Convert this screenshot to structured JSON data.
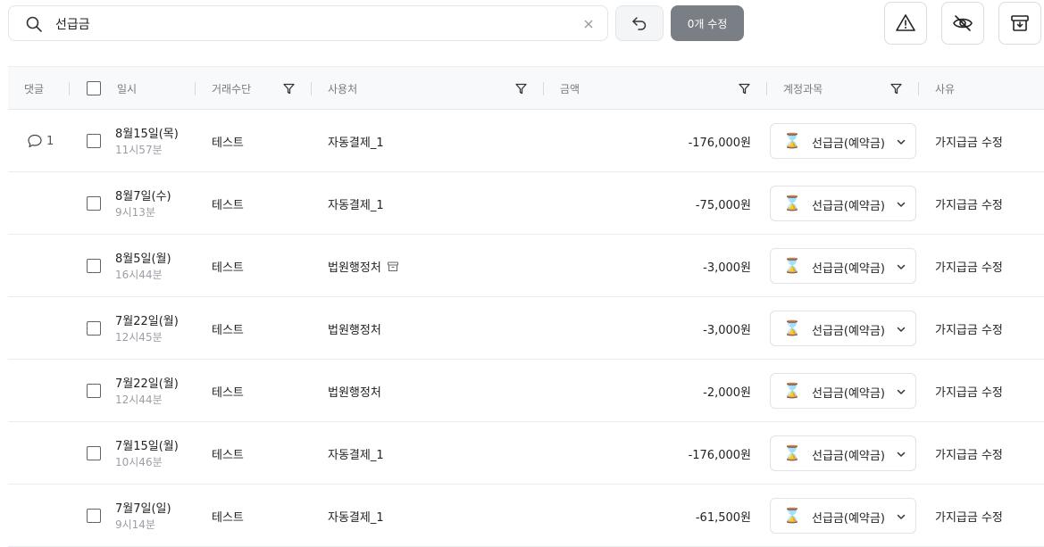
{
  "search": {
    "value": "선급금",
    "placeholder": ""
  },
  "toolbar": {
    "edit_label": "0개 수정"
  },
  "table": {
    "headers": {
      "comment": "댓글",
      "date": "일시",
      "method": "거래수단",
      "merchant": "사용처",
      "amount": "금액",
      "account": "계정과목",
      "reason": "사유"
    },
    "rows": [
      {
        "comments": "1",
        "date": "8월15일(목)",
        "time": "11시57분",
        "method": "테스트",
        "merchant": "자동결제_1",
        "amount": "-176,000원",
        "account": "선급금(예약금)",
        "reason": "가지급금 수정",
        "archived": false
      },
      {
        "comments": "",
        "date": "8월7일(수)",
        "time": "9시13분",
        "method": "테스트",
        "merchant": "자동결제_1",
        "amount": "-75,000원",
        "account": "선급금(예약금)",
        "reason": "가지급금 수정",
        "archived": false
      },
      {
        "comments": "",
        "date": "8월5일(월)",
        "time": "16시44분",
        "method": "테스트",
        "merchant": "법원행정처",
        "amount": "-3,000원",
        "account": "선급금(예약금)",
        "reason": "가지급금 수정",
        "archived": true
      },
      {
        "comments": "",
        "date": "7월22일(월)",
        "time": "12시45분",
        "method": "테스트",
        "merchant": "법원행정처",
        "amount": "-3,000원",
        "account": "선급금(예약금)",
        "reason": "가지급금 수정",
        "archived": false
      },
      {
        "comments": "",
        "date": "7월22일(월)",
        "time": "12시44분",
        "method": "테스트",
        "merchant": "법원행정처",
        "amount": "-2,000원",
        "account": "선급금(예약금)",
        "reason": "가지급금 수정",
        "archived": false
      },
      {
        "comments": "",
        "date": "7월15일(월)",
        "time": "10시46분",
        "method": "테스트",
        "merchant": "자동결제_1",
        "amount": "-176,000원",
        "account": "선급금(예약금)",
        "reason": "가지급금 수정",
        "archived": false
      },
      {
        "comments": "",
        "date": "7월7일(일)",
        "time": "9시14분",
        "method": "테스트",
        "merchant": "자동결제_1",
        "amount": "-61,500원",
        "account": "선급금(예약금)",
        "reason": "가지급금 수정",
        "archived": false
      }
    ]
  },
  "icons": {
    "account_icon": "hourglass-icon",
    "accent": "#7a7f86",
    "hourglass_glyph": "⌛"
  }
}
